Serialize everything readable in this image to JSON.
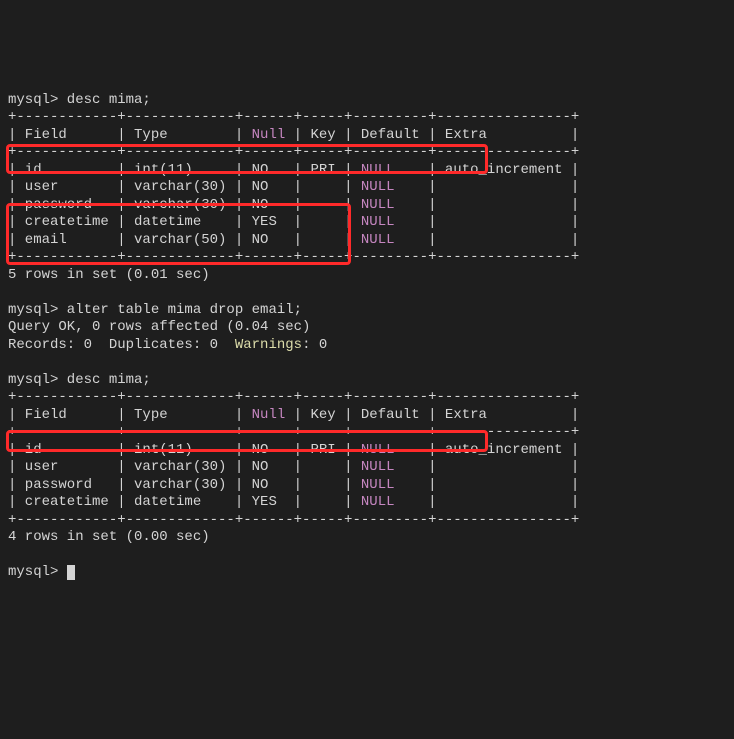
{
  "cmd1": "mysql> desc mima;",
  "border_top": "+------------+-------------+------+-----+---------+----------------+",
  "hdr_field": "| Field      ",
  "hdr_type": "| Type        ",
  "hdr_null_pipe": "| ",
  "hdr_null": "Null",
  "hdr_null_post": " ",
  "hdr_key": "| Key ",
  "hdr_default": "| Default ",
  "hdr_extra": "| Extra          |",
  "r_id_fld": "| id         ",
  "r_id_typ": "| int(11)     ",
  "r_id_nul": "| NO   ",
  "r_id_key": "| PRI ",
  "r_id_def": "NULL",
  "r_id_ext": "    | auto_increment |",
  "r_us_fld": "| user       ",
  "r_us_typ": "| varchar(30) ",
  "r_us_nul": "| NO   ",
  "r_us_key": "|     ",
  "r_us_def": "NULL",
  "r_us_ext": "    |                |",
  "r_pw_fld": "| password   ",
  "r_pw_typ": "| varchar(30) ",
  "r_pw_nul": "| NO   ",
  "r_pw_key": "|     ",
  "r_pw_def": "NULL",
  "r_pw_ext": "    |                |",
  "r_ct_fld": "| createtime ",
  "r_ct_typ": "| datetime    ",
  "r_ct_nul": "| YES  ",
  "r_ct_key": "|     ",
  "r_ct_def": "NULL",
  "r_ct_ext": "    |                |",
  "r_em_fld": "| email      ",
  "r_em_typ": "| varchar(50) ",
  "r_em_nul": "| NO   ",
  "r_em_key": "|     ",
  "r_em_def": "NULL",
  "r_em_ext": "    |                |",
  "rows1": "5 rows in set (0.01 sec)",
  "blank": "",
  "cmd2": "mysql> alter table mima drop email;",
  "qok": "Query OK, 0 rows affected (0.04 sec)",
  "rec_a": "Records: 0  Duplicates: 0  ",
  "rec_warn": "Warnings",
  "rec_b": ": 0",
  "rows2": "4 rows in set (0.00 sec)",
  "prompt": "mysql> ",
  "defpipe": "| "
}
